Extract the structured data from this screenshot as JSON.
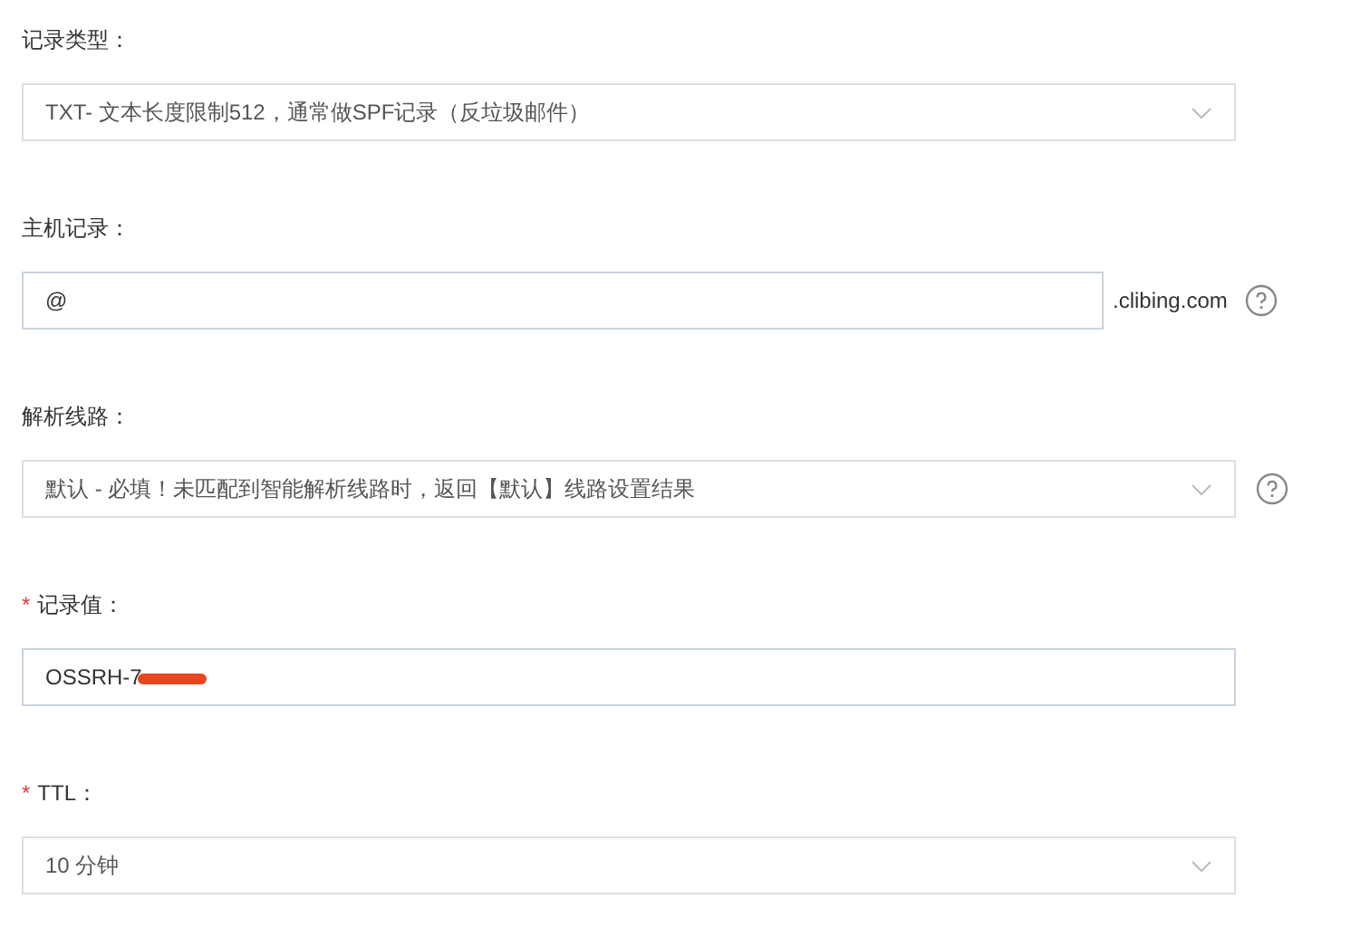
{
  "fields": [
    {
      "label": "记录类型：",
      "kind": "select",
      "value": "TXT- 文本长度限制512，通常做SPF记录（反垃圾邮件）",
      "help": false
    },
    {
      "label": "主机记录：",
      "kind": "input",
      "value": "@",
      "suffix": ".clibing.com",
      "help": true
    },
    {
      "label": "解析线路：",
      "kind": "select",
      "value": "默认 - 必填！未匹配到智能解析线路时，返回【默认】线路设置结果",
      "help": true
    },
    {
      "label": "记录值：",
      "required_mark": "*",
      "kind": "input",
      "value": "OSSRH-7",
      "redacted": true,
      "help": false
    },
    {
      "label": "TTL：",
      "required_mark": "*",
      "kind": "select",
      "value": "10 分钟",
      "help": false
    }
  ]
}
